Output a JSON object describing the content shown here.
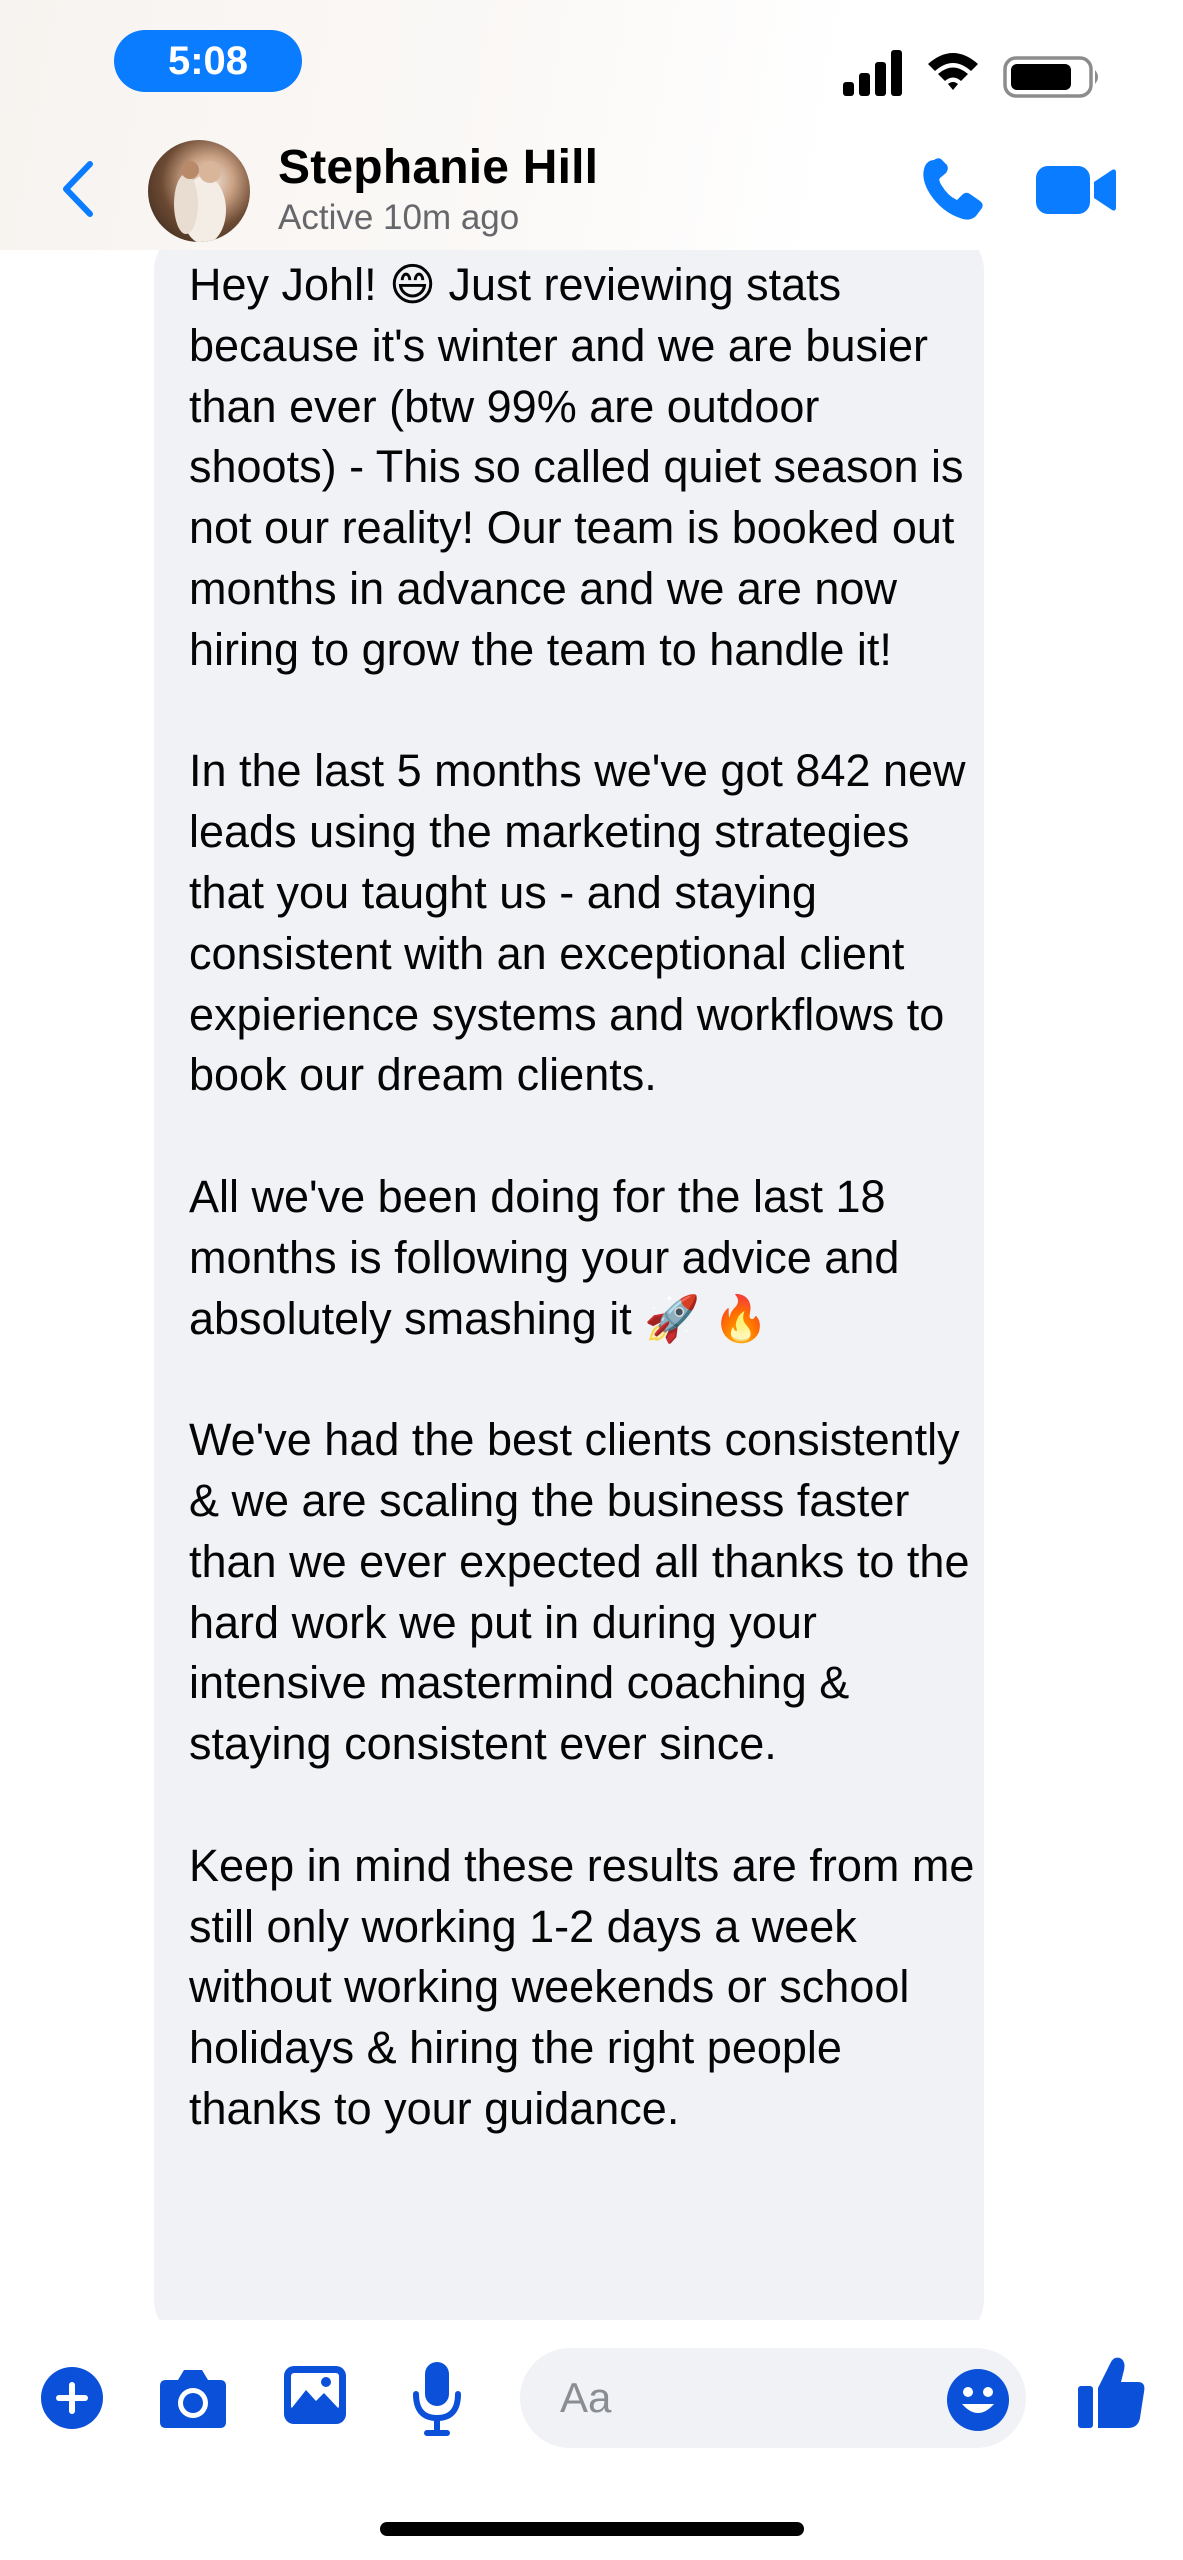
{
  "status_bar": {
    "time": "5:08"
  },
  "header": {
    "contact_name": "Stephanie Hill",
    "contact_status": "Active 10m ago"
  },
  "message": {
    "paragraphs": [
      "Hey Johl! 😄 Just reviewing stats because it's winter and we are busier than ever (btw 99% are outdoor shoots) - This so called quiet season is not our reality! Our team is booked out months in advance and we are now hiring to grow the team to handle it!",
      "In the last 5 months we've got 842 new leads using the marketing strategies that you taught us - and staying consistent with an exceptional client expierience systems and workflows to book our dream clients.",
      "All we've been doing for the last 18 months is following your advice and absolutely smashing it 🚀 🔥",
      "We've had the best clients consistently & we are scaling the business faster than we ever expected all thanks to the hard work we put in during your intensive mastermind coaching & staying consistent ever since.",
      "Keep in mind these results are from me still only working 1-2 days a week without working weekends or school holidays & hiring the right people thanks to your guidance."
    ]
  },
  "composer": {
    "placeholder": "Aa"
  },
  "icons": {
    "back": "chevron-left-icon",
    "call": "phone-icon",
    "video": "video-camera-icon",
    "add": "plus-circle-icon",
    "camera": "camera-icon",
    "gallery": "image-icon",
    "voice": "microphone-icon",
    "emoji": "smiley-icon",
    "like": "thumbs-up-icon"
  },
  "colors": {
    "accent": "#0a7cff",
    "like_blue": "#0a50d8",
    "bubble": "#f1f2f6",
    "secondary_text": "#65676b"
  }
}
